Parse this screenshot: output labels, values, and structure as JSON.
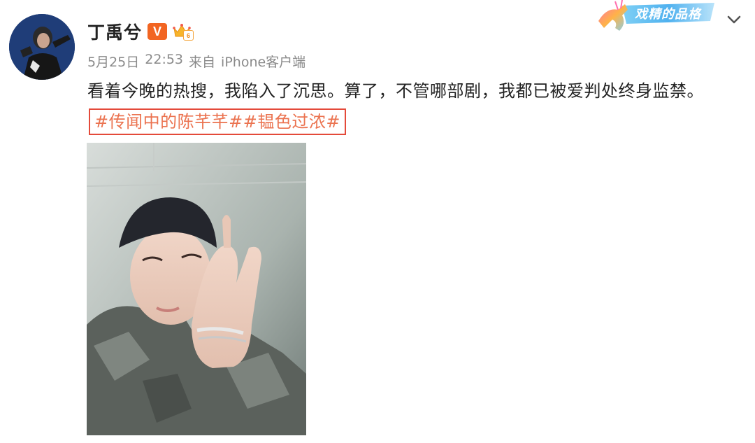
{
  "user": {
    "name": "丁禹兮",
    "vip_badge": "V",
    "crown_level": "6",
    "avatar_icon": "avatar-photo"
  },
  "meta": {
    "date": "5月25日",
    "time": "22:53",
    "source_prefix": "来自",
    "source": "iPhone客户端"
  },
  "banner": {
    "text": "戏精的品格",
    "icon": "deer-icon"
  },
  "post": {
    "text": "看着今晚的热搜，我陷入了沉思。算了，不管哪部剧，我都已被爱判处终身监禁。",
    "hashtags": [
      "#传闻中的陈芊芊#",
      "#韫色过浓#"
    ]
  },
  "photo": {
    "description_icon": "post-image"
  },
  "colors": {
    "hashtag": "#eb7350",
    "highlight_box": "#e44a3a",
    "vip": "#f26522",
    "meta": "#8a8a8a",
    "text": "#222222"
  }
}
